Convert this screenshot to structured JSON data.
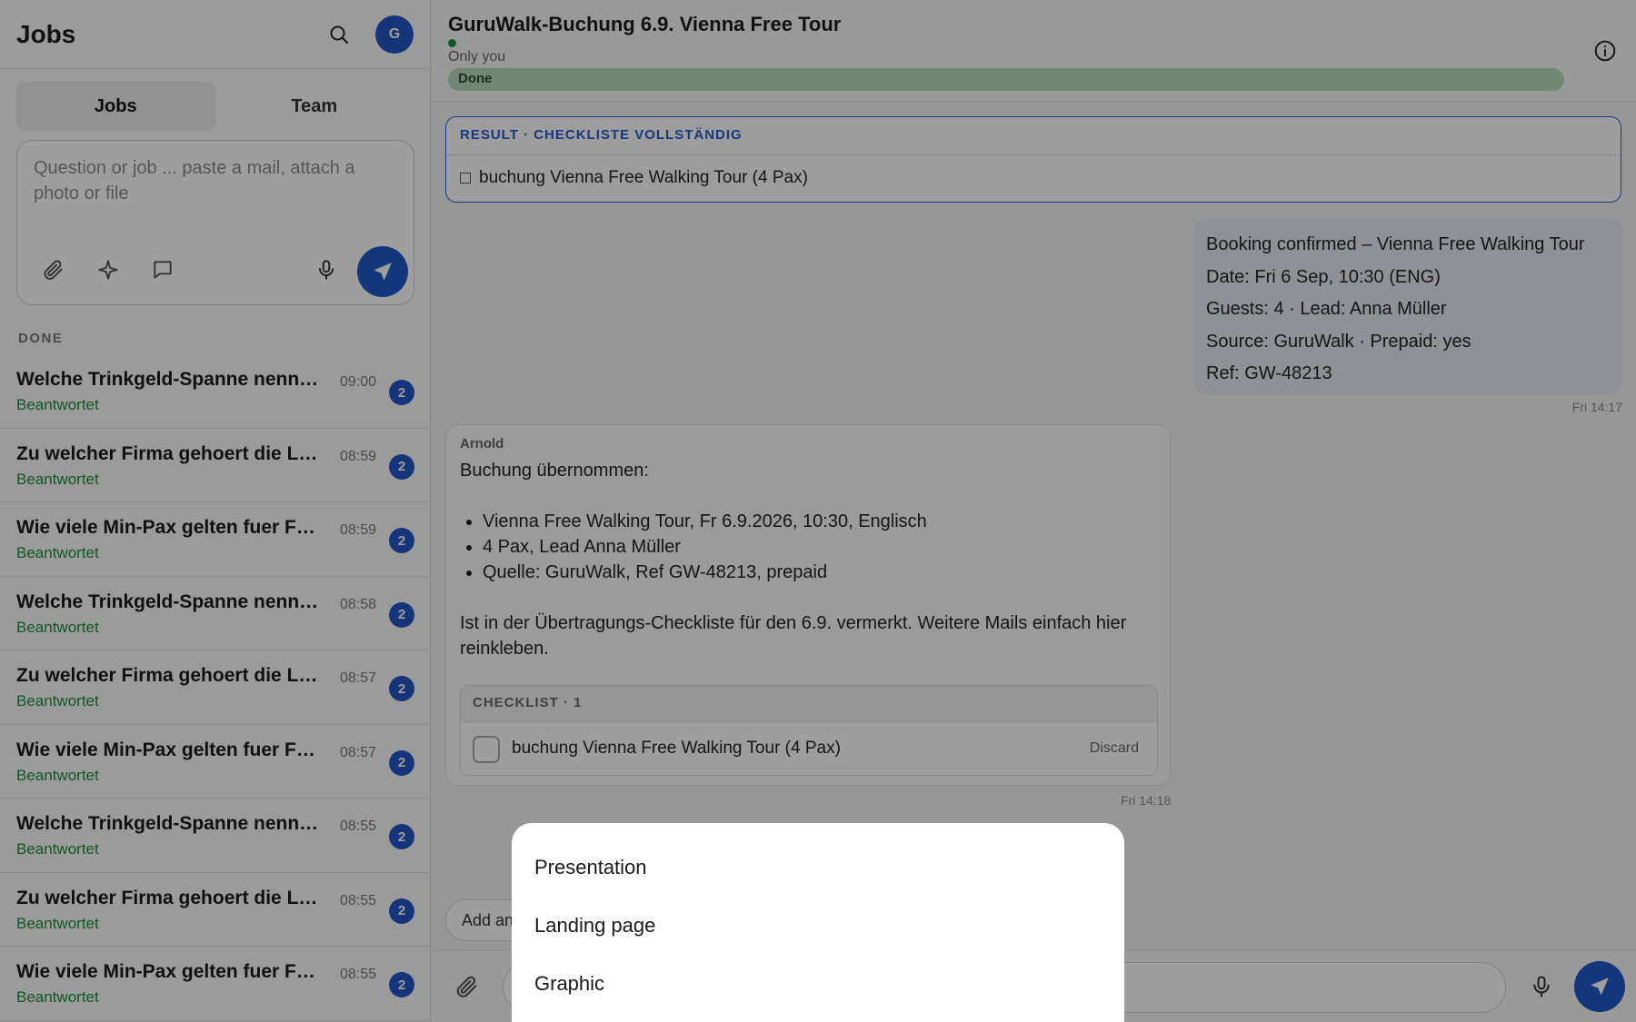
{
  "sidebar": {
    "title": "Jobs",
    "avatar_initial": "G",
    "tabs": [
      {
        "label": "Jobs",
        "active": true
      },
      {
        "label": "Team",
        "active": false
      }
    ],
    "composer": {
      "placeholder": "Question or job ... paste a mail, attach a photo or file"
    },
    "section_label": "DONE",
    "jobs": [
      {
        "title": "Welche Trinkgeld-Spanne nennt ...",
        "time": "09:00",
        "status": "Beantwortet",
        "badge": "2"
      },
      {
        "title": "Zu welcher Firma gehoert die Lea...",
        "time": "08:59",
        "status": "Beantwortet",
        "badge": "2"
      },
      {
        "title": "Wie viele Min-Pax gelten fuer Fre...",
        "time": "08:59",
        "status": "Beantwortet",
        "badge": "2"
      },
      {
        "title": "Welche Trinkgeld-Spanne nennt ...",
        "time": "08:58",
        "status": "Beantwortet",
        "badge": "2"
      },
      {
        "title": "Zu welcher Firma gehoert die Lea...",
        "time": "08:57",
        "status": "Beantwortet",
        "badge": "2"
      },
      {
        "title": "Wie viele Min-Pax gelten fuer Fre...",
        "time": "08:57",
        "status": "Beantwortet",
        "badge": "2"
      },
      {
        "title": "Welche Trinkgeld-Spanne nennt ...",
        "time": "08:55",
        "status": "Beantwortet",
        "badge": "2"
      },
      {
        "title": "Zu welcher Firma gehoert die Lea...",
        "time": "08:55",
        "status": "Beantwortet",
        "badge": "2"
      },
      {
        "title": "Wie viele Min-Pax gelten fuer Fre...",
        "time": "08:55",
        "status": "Beantwortet",
        "badge": "2"
      }
    ]
  },
  "main": {
    "title": "GuruWalk-Buchung 6.9. Vienna Free Tour",
    "visibility": "Only you",
    "progress": {
      "label": "Done",
      "percent": 100
    },
    "result": {
      "header": "RESULT · CHECKLISTE VOLLSTÄNDIG",
      "item": "buchung Vienna Free Walking Tour (4 Pax)"
    },
    "outgoing": {
      "lines": [
        "Booking confirmed – Vienna Free Walking Tour",
        "Date: Fri 6 Sep, 10:30 (ENG)",
        "Guests: 4 · Lead: Anna Müller",
        "Source: GuruWalk · Prepaid: yes",
        "Ref: GW-48213"
      ],
      "time": "Fri 14:17"
    },
    "incoming": {
      "sender": "Arnold",
      "intro": "Buchung übernommen:",
      "bullets": [
        "Vienna Free Walking Tour, Fr 6.9.2026, 10:30, Englisch",
        "4 Pax, Lead Anna Müller",
        "Quelle: GuruWalk, Ref GW-48213, prepaid"
      ],
      "outro": "Ist in der Übertragungs-Checkliste für den 6.9. vermerkt. Weitere Mails einfach hier reinkleben.",
      "checklist": {
        "header": "CHECKLIST · 1",
        "item": "buchung Vienna Free Walking Tour (4 Pax)",
        "discard_label": "Discard"
      },
      "time": "Fri 14:18"
    },
    "add_pill": "Add an"
  },
  "sheet": {
    "options": [
      "Presentation",
      "Landing page",
      "Graphic"
    ]
  },
  "colors": {
    "accent": "#2057c8",
    "status_green": "#1f8a3c",
    "result_border": "#2a5bc9"
  }
}
